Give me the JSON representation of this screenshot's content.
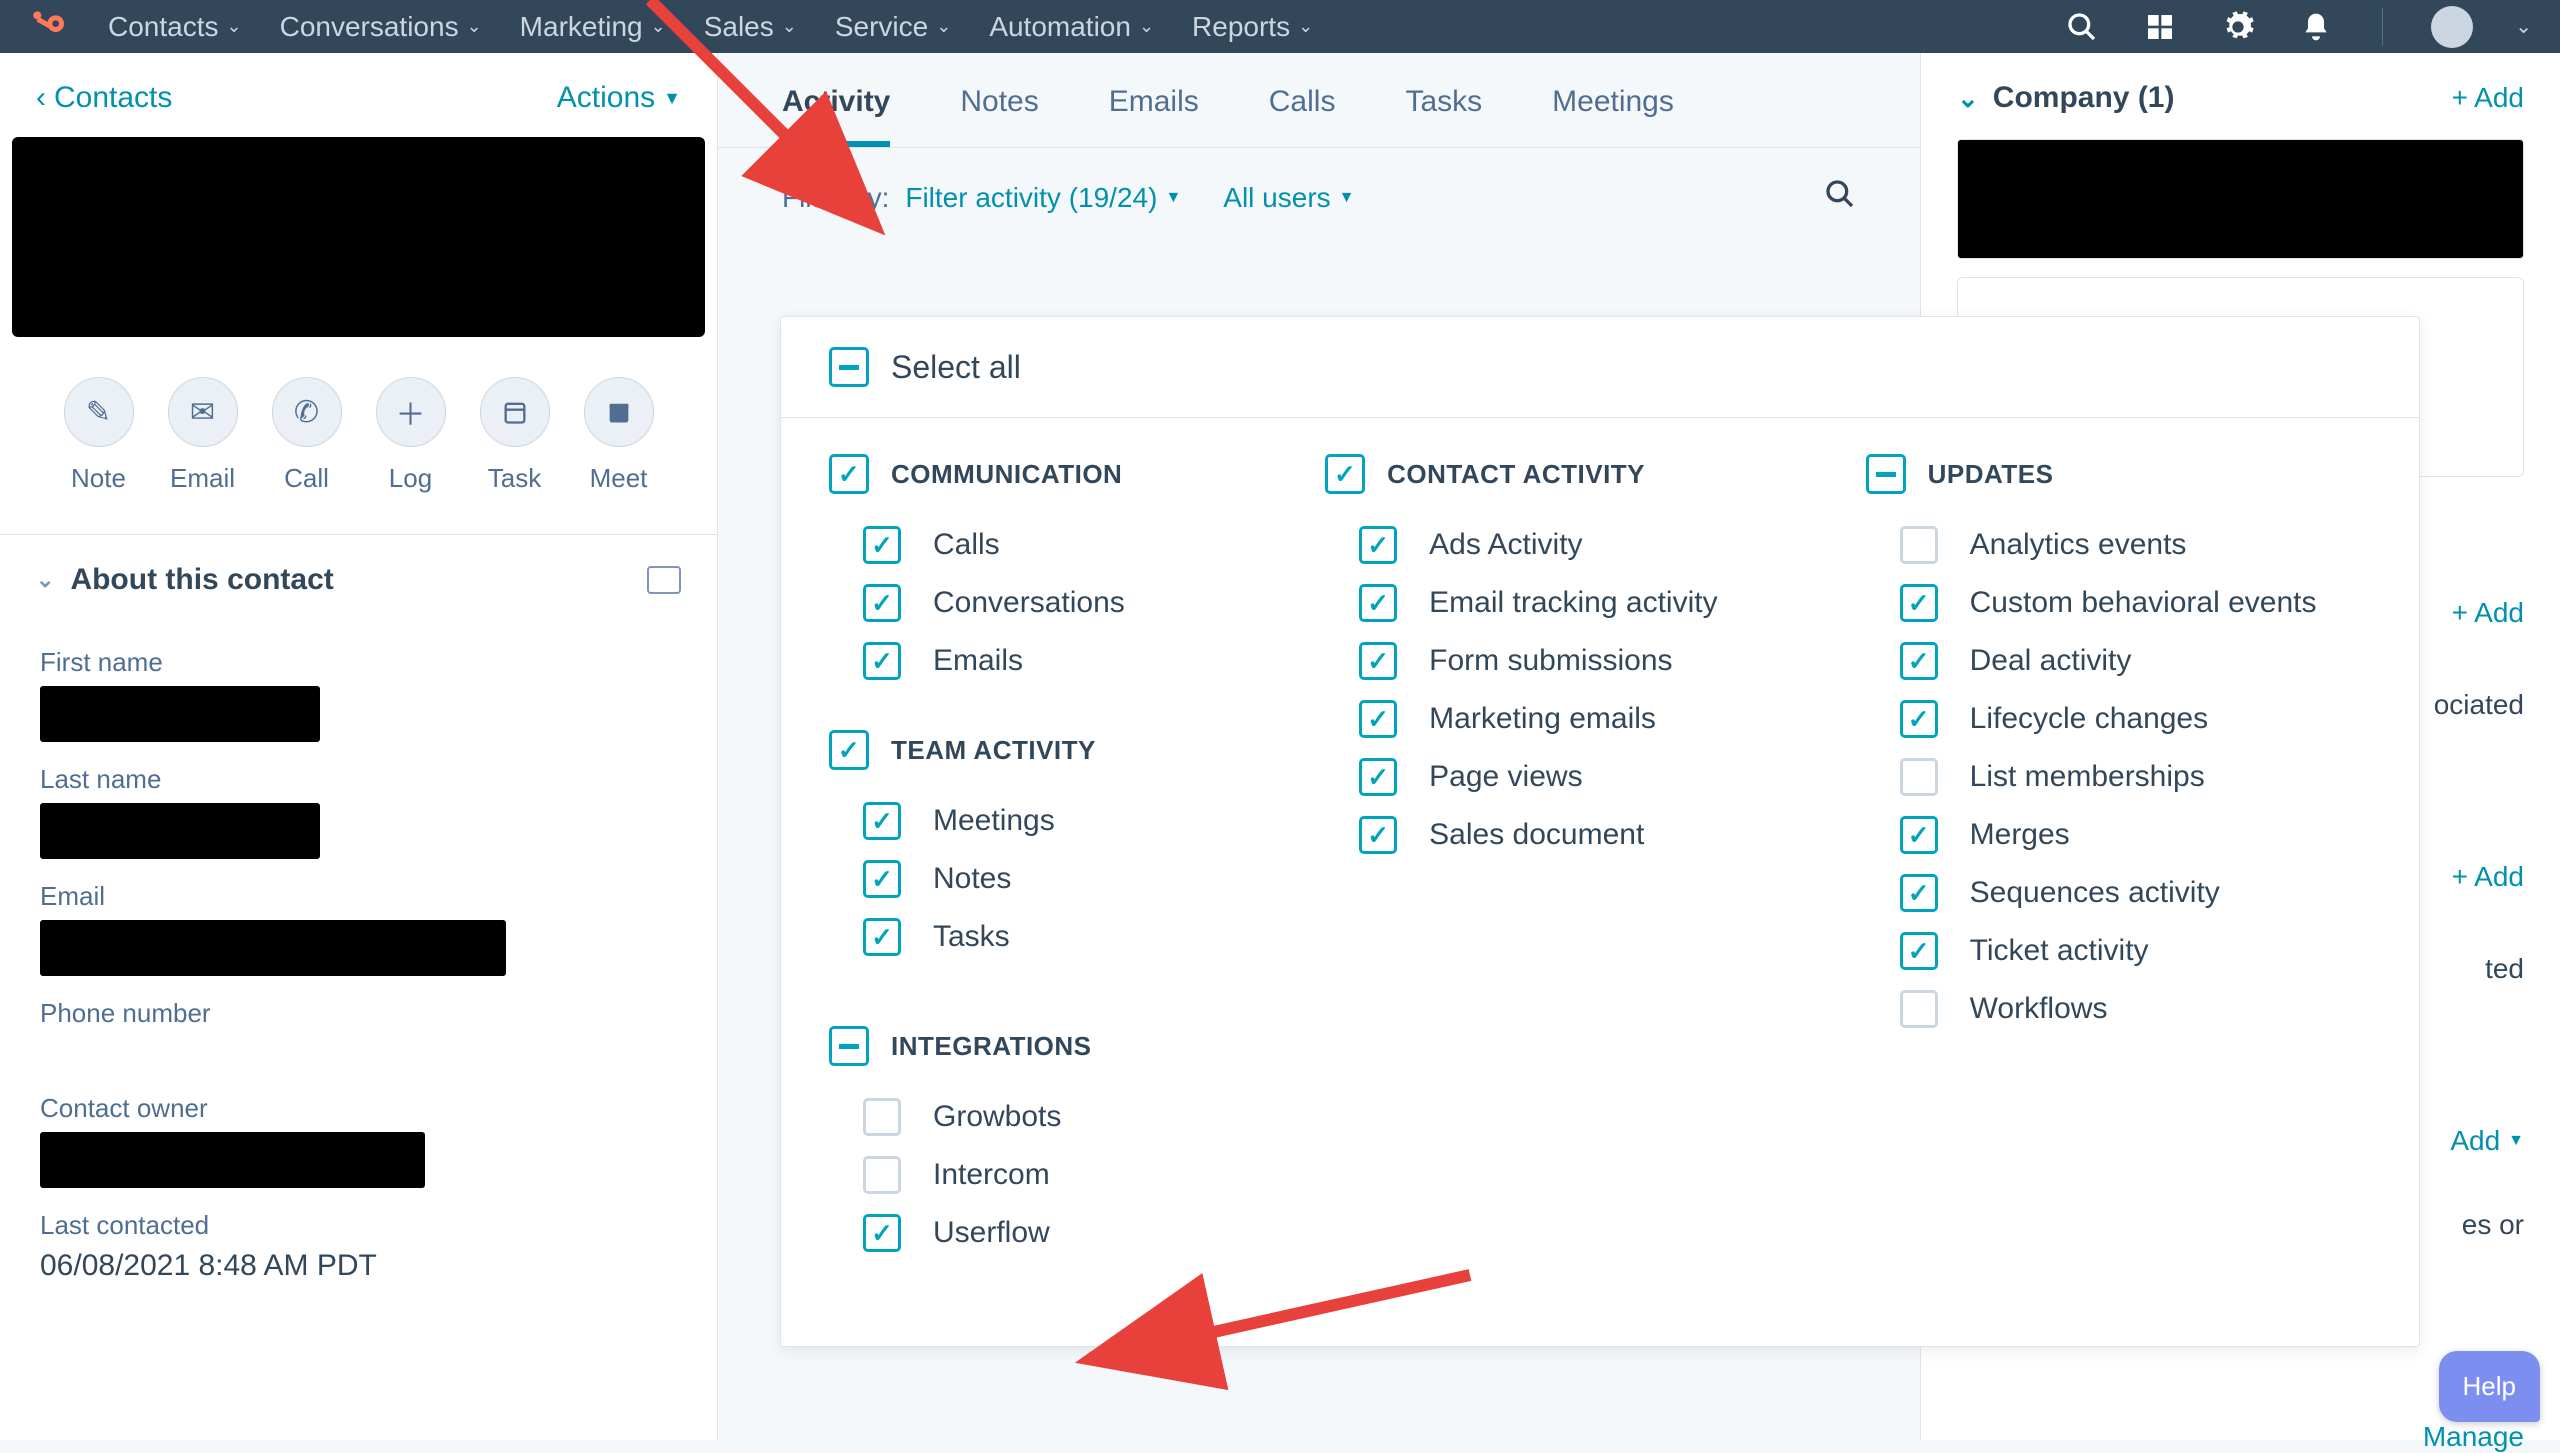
{
  "nav": {
    "items": [
      "Contacts",
      "Conversations",
      "Marketing",
      "Sales",
      "Service",
      "Automation",
      "Reports"
    ]
  },
  "left": {
    "back": "Contacts",
    "actions": "Actions",
    "buttons": [
      {
        "label": "Note",
        "icon": "note"
      },
      {
        "label": "Email",
        "icon": "email"
      },
      {
        "label": "Call",
        "icon": "call"
      },
      {
        "label": "Log",
        "icon": "log"
      },
      {
        "label": "Task",
        "icon": "task"
      },
      {
        "label": "Meet",
        "icon": "meet"
      }
    ],
    "about": "About this contact",
    "fields": {
      "first_name": "First name",
      "last_name": "Last name",
      "email": "Email",
      "phone": "Phone number",
      "owner": "Contact owner",
      "last_contacted": "Last contacted",
      "last_contacted_value": "06/08/2021 8:48 AM PDT"
    }
  },
  "tabs": [
    "Activity",
    "Notes",
    "Emails",
    "Calls",
    "Tasks",
    "Meetings"
  ],
  "filter": {
    "label": "Filter by:",
    "activity": "Filter activity (19/24)",
    "users": "All users"
  },
  "dropdown": {
    "select_all": "Select all",
    "groups": {
      "communication": {
        "title": "COMMUNICATION",
        "state": "checked",
        "items": [
          {
            "label": "Calls",
            "checked": true
          },
          {
            "label": "Conversations",
            "checked": true
          },
          {
            "label": "Emails",
            "checked": true
          }
        ]
      },
      "team": {
        "title": "TEAM ACTIVITY",
        "state": "checked",
        "items": [
          {
            "label": "Meetings",
            "checked": true
          },
          {
            "label": "Notes",
            "checked": true
          },
          {
            "label": "Tasks",
            "checked": true
          }
        ]
      },
      "integrations": {
        "title": "INTEGRATIONS",
        "state": "partial",
        "items": [
          {
            "label": "Growbots",
            "checked": false
          },
          {
            "label": "Intercom",
            "checked": false
          },
          {
            "label": "Userflow",
            "checked": true
          }
        ]
      },
      "contact": {
        "title": "CONTACT ACTIVITY",
        "state": "checked",
        "items": [
          {
            "label": "Ads Activity",
            "checked": true
          },
          {
            "label": "Email tracking activity",
            "checked": true
          },
          {
            "label": "Form submissions",
            "checked": true
          },
          {
            "label": "Marketing emails",
            "checked": true
          },
          {
            "label": "Page views",
            "checked": true
          },
          {
            "label": "Sales document",
            "checked": true
          }
        ]
      },
      "updates": {
        "title": "UPDATES",
        "state": "partial",
        "items": [
          {
            "label": "Analytics events",
            "checked": false
          },
          {
            "label": "Custom behavioral events",
            "checked": true
          },
          {
            "label": "Deal activity",
            "checked": true
          },
          {
            "label": "Lifecycle changes",
            "checked": true
          },
          {
            "label": "List memberships",
            "checked": false
          },
          {
            "label": "Merges",
            "checked": true
          },
          {
            "label": "Sequences activity",
            "checked": true
          },
          {
            "label": "Ticket activity",
            "checked": true
          },
          {
            "label": "Workflows",
            "checked": false
          }
        ]
      }
    }
  },
  "right": {
    "company": "Company (1)",
    "add": "+ Add",
    "snip1": "ociated",
    "snip2": "ted",
    "snip3": "Add",
    "snip4": "es or",
    "manage": "Manage"
  },
  "help": "Help"
}
